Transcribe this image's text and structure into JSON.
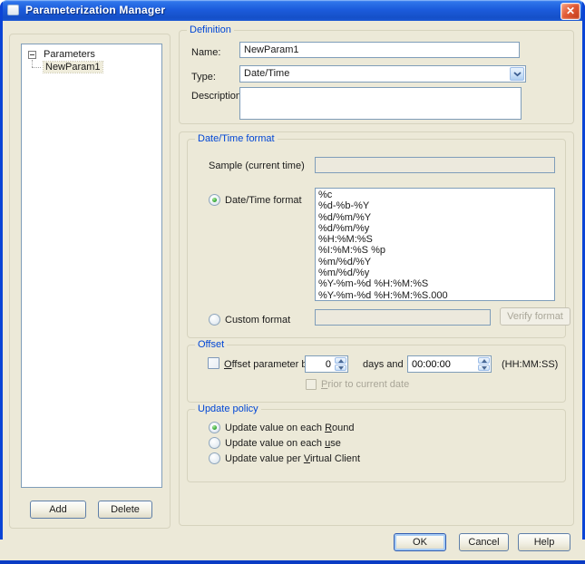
{
  "window": {
    "title": "Parameterization Manager",
    "close_glyph": "✕"
  },
  "tree": {
    "root_label": "Parameters",
    "child_label": "NewParam1",
    "add_button": "Add",
    "delete_button": "Delete"
  },
  "definition": {
    "caption": "Definition",
    "name_label": "Name:",
    "name_value": "NewParam1",
    "type_label": "Type:",
    "type_value": "Date/Time",
    "description_label": "Description",
    "description_value": ""
  },
  "datetime_format": {
    "caption": "Date/Time format",
    "sample_label": "Sample (current time)",
    "sample_value": "",
    "radio_datetime_label": "Date/Time format",
    "formats": [
      "%c",
      "%d-%b-%Y",
      "%d/%m/%Y",
      "%d/%m/%y",
      "%H:%M:%S",
      "%I:%M:%S %p",
      "%m/%d/%Y",
      "%m/%d/%y",
      "%Y-%m-%d %H:%M:%S",
      "%Y-%m-%d %H:%M:%S.000"
    ],
    "radio_custom_label": "Custom format",
    "custom_value": "",
    "verify_button": "Verify format"
  },
  "offset": {
    "caption": "Offset",
    "checkbox": {
      "before": "",
      "key": "O",
      "after": "ffset parameter by"
    },
    "days_value": "0",
    "days_and_label": "days and",
    "time_value": "00:00:00",
    "hhmmss_label": "(HH:MM:SS)",
    "prior": {
      "before": "",
      "key": "P",
      "after": "rior to current date"
    }
  },
  "update_policy": {
    "caption": "Update policy",
    "round": {
      "before": "Update value on each ",
      "key": "R",
      "after": "ound"
    },
    "use": {
      "before": "Update value on each ",
      "key": "u",
      "after": "se"
    },
    "vc": {
      "before": "Update value per ",
      "key": "V",
      "after": "irtual Client"
    }
  },
  "footer": {
    "ok": "OK",
    "cancel": "Cancel",
    "help": "Help"
  },
  "colors": {
    "dialog_bg": "#ECE9D8",
    "titlebar_blue": "#1C5CDC",
    "frame_blue": "#0A44D6",
    "caption_blue": "#0046D5",
    "field_border": "#7F9DB9",
    "close_red": "#D9502E",
    "radio_green": "#2DA32D"
  }
}
